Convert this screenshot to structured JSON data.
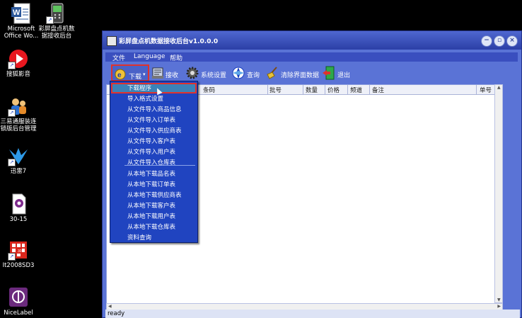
{
  "desktop": {
    "icons": [
      {
        "label1": "Microsoft",
        "label2": "Office Wo...",
        "icon": "word-document-icon"
      },
      {
        "label1": "彩屏盘点机数",
        "label2": "据接收后台",
        "icon": "pda-scanner-icon"
      },
      {
        "label1": "搜狐影音",
        "label2": "",
        "icon": "sohu-video-icon"
      },
      {
        "label1": "三易通服装连",
        "label2": "锁版后台管理",
        "icon": "people-icon"
      },
      {
        "label1": "迅雷7",
        "label2": "",
        "icon": "thunder-bird-icon"
      },
      {
        "label1": "30-15",
        "label2": "",
        "icon": "file-icon"
      },
      {
        "label1": "It2008SD3",
        "label2": "",
        "icon": "grid-app-icon"
      },
      {
        "label1": "NiceLabel",
        "label2": "",
        "icon": "nicelabel-icon"
      }
    ]
  },
  "window": {
    "title": "彩屏盘点机数据接收后台v1.0.0.0",
    "controls": {
      "minimize": "−",
      "restore": "▫",
      "close": "×"
    }
  },
  "menu": {
    "file": "文件",
    "language": "Language",
    "help": "帮助"
  },
  "toolbar": {
    "download": "下载",
    "receive": "接收",
    "settings": "系统设置",
    "query": "查询",
    "clear": "清除界面数据",
    "exit": "退出"
  },
  "table": {
    "columns": [
      "条码",
      "批号",
      "数量",
      "价格",
      "频道",
      "备注",
      "单号"
    ]
  },
  "dropdown": {
    "items_top": [
      "下载程序",
      "导入格式设置",
      "从文件导入商品信息",
      "从文件导入订单表",
      "从文件导入供应商表",
      "从文件导入客户表",
      "从文件导入用户表",
      "从文件导入仓库表"
    ],
    "items_bottom": [
      "从本地下载品名表",
      "从本地下载订单表",
      "从本地下载供应商表",
      "从本地下载客户表",
      "从本地下载用户表",
      "从本地下载仓库表",
      "资料查询"
    ]
  },
  "status": {
    "text": "ready"
  },
  "colors": {
    "window_bg": "#5a73d6",
    "menu_bg": "#2044c0",
    "highlight_border": "#e0322c"
  }
}
